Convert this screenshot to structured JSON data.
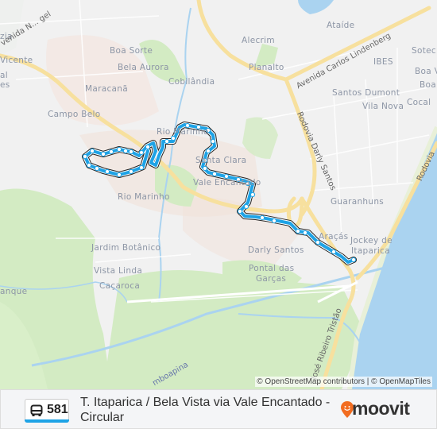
{
  "map": {
    "attribution": "© OpenStreetMap contributors | © OpenMapTiles",
    "route_color": "#1ea3e6",
    "places": [
      {
        "name": "Boa Sorte"
      },
      {
        "name": "Bela Aurora"
      },
      {
        "name": "Cobilândia"
      },
      {
        "name": "Maracanã"
      },
      {
        "name": "Campo Belo"
      },
      {
        "name": "Alecrim"
      },
      {
        "name": "Ataíde"
      },
      {
        "name": "Planalto"
      },
      {
        "name": "IBES"
      },
      {
        "name": "Sotec"
      },
      {
        "name": "Boa V"
      },
      {
        "name": "Boa"
      },
      {
        "name": "Santos Dumont"
      },
      {
        "name": "Cocal"
      },
      {
        "name": "Vila Nova"
      },
      {
        "name": "Rio Marinho"
      },
      {
        "name": "Santa Clara"
      },
      {
        "name": "Vale Encantado"
      },
      {
        "name": "Rio Marinho"
      },
      {
        "name": "Guaranhuns"
      },
      {
        "name": "Araçás"
      },
      {
        "name": "Jockey de"
      },
      {
        "name": "Itaparica"
      },
      {
        "name": "Darly Santos"
      },
      {
        "name": "Pontal das"
      },
      {
        "name": "Garças"
      },
      {
        "name": "Jardim Botânico"
      },
      {
        "name": "Vista Linda"
      },
      {
        "name": "Caçaroca"
      },
      {
        "name": "anque"
      },
      {
        "name": "zia"
      },
      {
        "name": "Vicente"
      },
      {
        "name": "al"
      },
      {
        "name": "es"
      }
    ],
    "roads": [
      {
        "name": "Avenida Carlos Lindenberg"
      },
      {
        "name": "Rodovia Darly Santos"
      },
      {
        "name": "José Ribeiro Tristão"
      },
      {
        "name": "Rodovia"
      },
      {
        "name": "venida N... gel"
      },
      {
        "name": "mboapina"
      }
    ]
  },
  "footer": {
    "route_number": "581",
    "route_name": "T. Itaparica / Bela Vista via Vale Encantado - Circular",
    "brand": "moovit",
    "icons": {
      "bus": "bus-icon",
      "logo": "moovit-pin-icon"
    }
  }
}
